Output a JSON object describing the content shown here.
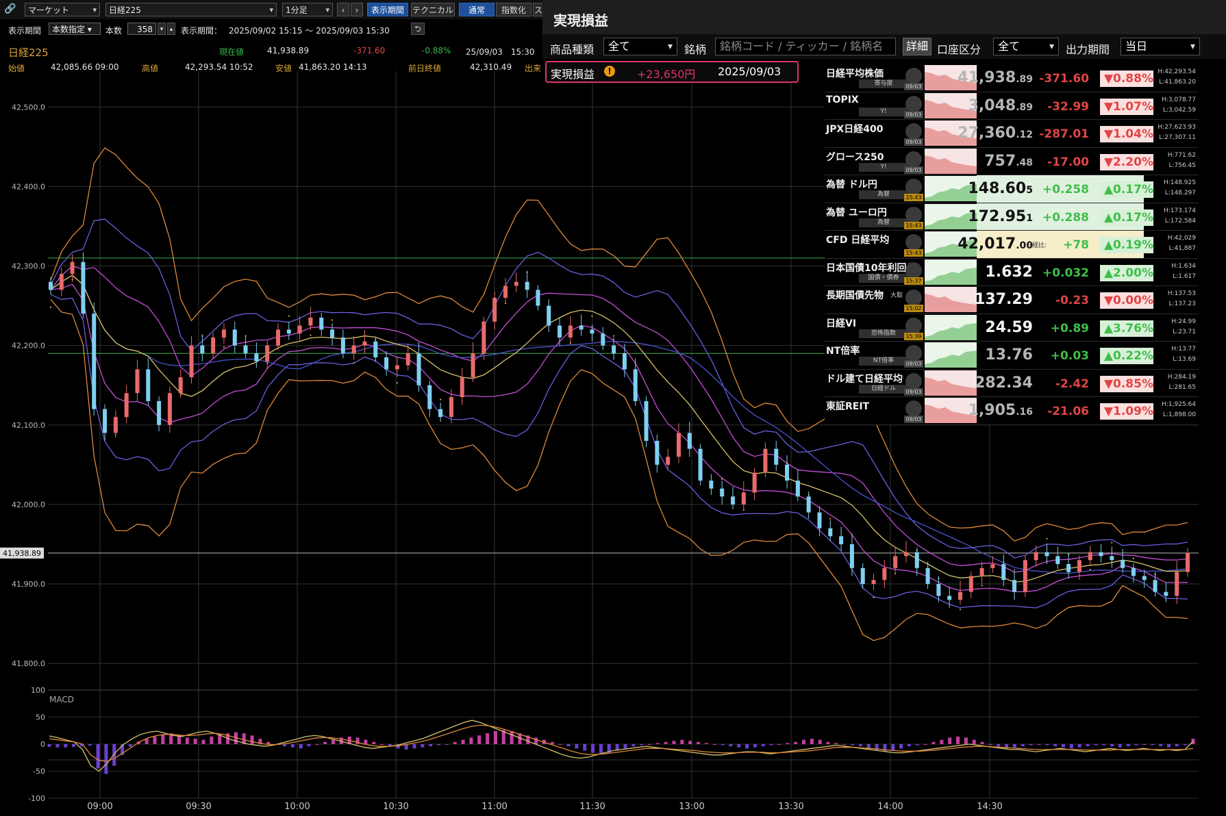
{
  "toolbar": {
    "market_select": "マーケット",
    "symbol_select": "日経225",
    "interval_select": "1分足",
    "btn_period": "表示期間",
    "btn_technical": "テクニカル",
    "btn_normal": "通常",
    "btn_index": "指数化",
    "btn_cut": "ス"
  },
  "row2": {
    "period_label": "表示期間",
    "period_mode": "本数指定",
    "count_label": "本数",
    "count_value": "358",
    "range_label": "表示期間：",
    "range_value": "2025/09/02 15:15 ～ 2025/09/03 15:30"
  },
  "info": {
    "name": "日経225",
    "current_label": "現在値",
    "current_value": "41,938.89",
    "change": "-371.60",
    "change_pct": "-0.88%",
    "timestamp": "25/09/03　15:30",
    "open_label": "始値",
    "open_value": "42,085.66 09:00",
    "high_label": "高値",
    "high_value": "42,293.54 10:52",
    "low_label": "安値",
    "low_value": "41,863.20 14:13",
    "prev_label": "前日終値",
    "prev_value": "42,310.49",
    "trunc": "出来"
  },
  "chart_data": {
    "type": "line",
    "title": "",
    "y_ticks": [
      "42,500.0",
      "42,400.0",
      "42,300.0",
      "42,200.0",
      "42,100.0",
      "42,000.0",
      "41,900.0",
      "41,800.0"
    ],
    "x_ticks": [
      "09:00",
      "09:30",
      "10:00",
      "10:30",
      "11:00",
      "11:30",
      "13:00",
      "13:30",
      "14:00",
      "14:30"
    ],
    "ylim": [
      41770,
      42545
    ],
    "current_price_label": "41,938.89",
    "hlines": [
      42310,
      42190
    ],
    "series": [
      {
        "values": [
          42270,
          42290,
          42305,
          42240,
          42120,
          42090,
          42110,
          42140,
          42170,
          42130,
          42100,
          42140,
          42160,
          42200,
          42190,
          42210,
          42220,
          42200,
          42190,
          42180,
          42200,
          42220,
          42215,
          42225,
          42235,
          42220,
          42210,
          42190,
          42200,
          42205,
          42185,
          42170,
          42175,
          42190,
          42150,
          42120,
          42110,
          42135,
          42160,
          42190,
          42230,
          42260,
          42275,
          42280,
          42270,
          42250,
          42225,
          42210,
          42225,
          42220,
          42215,
          42200,
          42190,
          42170,
          42130,
          42080,
          42050,
          42060,
          42090,
          42070,
          42030,
          42020,
          42010,
          42000,
          42015,
          42040,
          42070,
          42050,
          42030,
          42010,
          41990,
          41970,
          41960,
          41950,
          41920,
          41900,
          41905,
          41920,
          41935,
          41940,
          41920,
          41900,
          41885,
          41880,
          41890,
          41910,
          41920,
          41925,
          41905,
          41890,
          41930,
          41940,
          41935,
          41925,
          41915,
          41930,
          41940,
          41935,
          41930,
          41920,
          41910,
          41905,
          41890,
          41885,
          41915,
          41939
        ]
      }
    ],
    "macd": {
      "label": "MACD",
      "y_ticks": [
        "100",
        "50",
        "0",
        "-50",
        "-100"
      ],
      "ylim": [
        -100,
        100
      ],
      "hist": [
        -5,
        -6,
        -6,
        -5,
        -4,
        -3,
        -45,
        -55,
        -40,
        -20,
        -5,
        5,
        10,
        14,
        18,
        20,
        16,
        12,
        10,
        8,
        14,
        18,
        20,
        22,
        20,
        16,
        10,
        4,
        0,
        -4,
        -6,
        -8,
        -4,
        0,
        4,
        8,
        12,
        14,
        12,
        8,
        4,
        0,
        -4,
        -8,
        -10,
        -8,
        -6,
        -4,
        -2,
        0,
        4,
        8,
        12,
        16,
        20,
        24,
        26,
        24,
        20,
        16,
        12,
        8,
        4,
        0,
        -4,
        -8,
        -12,
        -16,
        -18,
        -16,
        -12,
        -8,
        -4,
        -2,
        0,
        2,
        4,
        6,
        8,
        6,
        4,
        2,
        0,
        -2,
        -4,
        -6,
        -8,
        -6,
        -4,
        -2,
        0,
        2,
        4,
        8,
        10,
        8,
        4,
        2,
        0,
        -2,
        -4,
        -8,
        -12,
        -14,
        -12,
        -8,
        -4,
        -2,
        0,
        4,
        8,
        12,
        14,
        12,
        8,
        4,
        0,
        -4,
        -8,
        -6,
        -4,
        -2,
        0,
        -2,
        -4,
        -6,
        -8,
        -6,
        -4,
        -2,
        -2,
        -4,
        -6,
        -4,
        -2,
        0,
        -2,
        -4,
        -6,
        -4,
        -2,
        10
      ],
      "macd_line": [
        15,
        12,
        8,
        4,
        -10,
        -40,
        -50,
        -35,
        -15,
        0,
        10,
        18,
        22,
        24,
        20,
        16,
        14,
        18,
        22,
        24,
        20,
        14,
        8,
        4,
        0,
        -2,
        -4,
        -2,
        2,
        6,
        10,
        14,
        16,
        14,
        10,
        6,
        2,
        -2,
        -6,
        -8,
        -6,
        -4,
        -2,
        2,
        6,
        10,
        16,
        22,
        28,
        34,
        40,
        44,
        40,
        34,
        28,
        22,
        16,
        10,
        4,
        -2,
        -8,
        -14,
        -20,
        -24,
        -26,
        -24,
        -20,
        -16,
        -12,
        -10,
        -8,
        -6,
        -4,
        -6,
        -8,
        -10,
        -12,
        -14,
        -16,
        -18,
        -20,
        -20,
        -18,
        -16,
        -14,
        -14,
        -16,
        -18,
        -16,
        -14,
        -12,
        -10,
        -8,
        -6,
        -4,
        -2,
        -4,
        -6,
        -8,
        -10,
        -12,
        -14,
        -16,
        -16,
        -14,
        -12,
        -10,
        -8,
        -6,
        -4,
        -2,
        0,
        -2,
        -4,
        -6,
        -8,
        -10,
        -10,
        -12,
        -14,
        -12,
        -10,
        -8,
        -10,
        -12,
        -14,
        -12,
        -10,
        -8,
        -10,
        -12,
        -10,
        -8,
        -10,
        -12,
        -10,
        -12,
        -10,
        5
      ],
      "signal_line": [
        10,
        8,
        6,
        4,
        0,
        -20,
        -30,
        -32,
        -25,
        -15,
        -5,
        5,
        12,
        16,
        18,
        18,
        16,
        16,
        17,
        19,
        20,
        18,
        14,
        10,
        6,
        3,
        0,
        -1,
        0,
        2,
        5,
        8,
        11,
        12,
        12,
        10,
        7,
        4,
        0,
        -3,
        -4,
        -4,
        -3,
        -1,
        2,
        5,
        9,
        14,
        19,
        24,
        29,
        33,
        35,
        34,
        31,
        27,
        22,
        17,
        12,
        7,
        2,
        -3,
        -8,
        -13,
        -17,
        -19,
        -19,
        -18,
        -16,
        -14,
        -12,
        -10,
        -8,
        -8,
        -8,
        -9,
        -10,
        -11,
        -12,
        -14,
        -15,
        -16,
        -16,
        -16,
        -15,
        -15,
        -15,
        -16,
        -16,
        -15,
        -14,
        -13,
        -12,
        -10,
        -8,
        -6,
        -6,
        -6,
        -7,
        -8,
        -9,
        -11,
        -12,
        -13,
        -13,
        -13,
        -12,
        -11,
        -9,
        -8,
        -6,
        -5,
        -4,
        -4,
        -5,
        -6,
        -7,
        -8,
        -9,
        -10,
        -10,
        -10,
        -10,
        -10,
        -10,
        -11,
        -11,
        -11,
        -11,
        -10,
        -10,
        -10,
        -10,
        -10,
        -10,
        -10,
        -10,
        -10,
        -8
      ]
    }
  },
  "pl": {
    "title": "実現損益",
    "product_label": "商品種類",
    "product_value": "全て",
    "symbol_label": "銘柄",
    "symbol_placeholder": "銘柄コード / ティッカー / 銘柄名",
    "detail_btn": "詳細",
    "account_label": "口座区分",
    "account_value": "全て",
    "period_label": "出力期間",
    "period_value": "当日",
    "result_label": "実現損益",
    "result_value": "+23,650円",
    "result_date": "2025/09/03"
  },
  "market": [
    {
      "name": "日経平均株価",
      "sub": "寄与度",
      "time": "09/03",
      "price": "41,938",
      "dec": ".89",
      "chg": "-371.60",
      "pct": "▼0.88%",
      "h": "H:42,293.54",
      "l": "L:41,863.20",
      "up": false,
      "price_style": "gray"
    },
    {
      "name": "TOPIX",
      "sub": "Y!",
      "time": "09/03",
      "price": "3,048",
      "dec": ".89",
      "chg": "-32.99",
      "pct": "▼1.07%",
      "h": "H:3,078.77",
      "l": "L:3,042.59",
      "up": false,
      "price_style": "gray"
    },
    {
      "name": "JPX日経400",
      "sub": "",
      "time": "09/03",
      "price": "27,360",
      "dec": ".12",
      "chg": "-287.01",
      "pct": "▼1.04%",
      "h": "H:27,623.93",
      "l": "L:27,307.11",
      "up": false,
      "price_style": "gray"
    },
    {
      "name": "グロース250",
      "sub": "Y!",
      "time": "09/03",
      "price": "757",
      "dec": ".48",
      "chg": "-17.00",
      "pct": "▼2.20%",
      "h": "H:771.62",
      "l": "L:756.45",
      "up": false,
      "price_style": "gray"
    },
    {
      "name": "為替 ドル円",
      "sub": "為替",
      "time": "15:43",
      "price": "148.60",
      "dec": "5",
      "chg": "+0.258",
      "pct": "▲0.17%",
      "h": "H:148.925",
      "l": "L:148.297",
      "up": true,
      "price_style": "blk"
    },
    {
      "name": "為替 ユーロ円",
      "sub": "為替",
      "time": "15:43",
      "price": "172.95",
      "dec": "1",
      "chg": "+0.288",
      "pct": "▲0.17%",
      "h": "H:173.174",
      "l": "L:172.584",
      "up": true,
      "price_style": "blk"
    },
    {
      "name": "CFD 日経平均",
      "sub": "",
      "time": "15:43",
      "price": "42,017",
      "dec": ".00",
      "chg": "+78",
      "pct": "▲0.19%",
      "h": "H:42,029",
      "l": "L:41,887",
      "up": true,
      "price_style": "blk",
      "extra": "日経比:"
    },
    {
      "name": "日本国債10年利回り",
      "sub": "国債・債券",
      "time": "15:37",
      "price": "1.632",
      "dec": "",
      "chg": "+0.032",
      "pct": "▲2.00%",
      "h": "H:1.634",
      "l": "L:1.617",
      "up": true,
      "price_style": "white"
    },
    {
      "name": "長期国債先物",
      "sub": "",
      "time": "15:02",
      "price": "137.29",
      "dec": "",
      "chg": "-0.23",
      "pct": "▼0.00%",
      "h": "H:137.53",
      "l": "L:137.23",
      "up": false,
      "price_style": "white",
      "suffix": "大取"
    },
    {
      "name": "日経VI",
      "sub": "恐怖指数",
      "time": "15:39",
      "price": "24.59",
      "dec": "",
      "chg": "+0.89",
      "pct": "▲3.76%",
      "h": "H:24.99",
      "l": "L:23.71",
      "up": true,
      "price_style": "white"
    },
    {
      "name": "NT倍率",
      "sub": "NT倍率",
      "time": "09/03",
      "price": "13.76",
      "dec": "",
      "chg": "+0.03",
      "pct": "▲0.22%",
      "h": "H:13.77",
      "l": "L:13.69",
      "up": true,
      "price_style": "gray"
    },
    {
      "name": "ドル建て日経平均",
      "sub": "日経ドル",
      "time": "09/03",
      "price": "282.34",
      "dec": "",
      "chg": "-2.42",
      "pct": "▼0.85%",
      "h": "H:284.19",
      "l": "L:281.65",
      "up": false,
      "price_style": "gray"
    },
    {
      "name": "東証REIT",
      "sub": "",
      "time": "09/03",
      "price": "1,905",
      "dec": ".16",
      "chg": "-21.06",
      "pct": "▼1.09%",
      "h": "H:1,925.64",
      "l": "L:1,898.00",
      "up": false,
      "price_style": "gray"
    }
  ]
}
